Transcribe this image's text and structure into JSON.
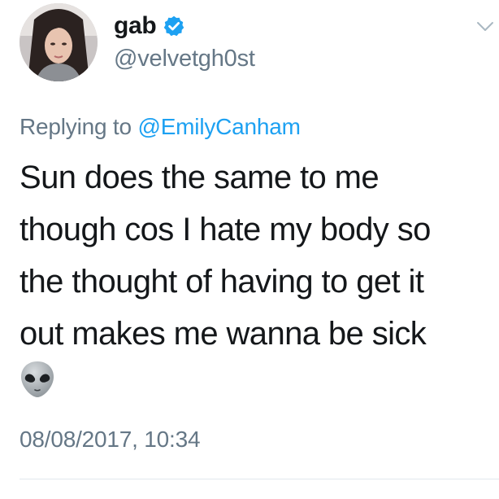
{
  "user": {
    "display_name": "gab",
    "handle": "@velvetgh0st",
    "verified": true
  },
  "reply": {
    "prefix": "Replying to ",
    "mention": "@EmilyCanham"
  },
  "tweet": {
    "lines": [
      "Sun does the same to me",
      "though cos I hate my body so",
      "the thought of having to get it",
      "out makes me wanna be sick"
    ],
    "emoji": "👽",
    "timestamp": "08/08/2017, 10:34"
  },
  "icons": {
    "verified": "verified-badge-icon",
    "menu": "chevron-down-icon",
    "emoji": "alien-emoji-icon"
  },
  "colors": {
    "accent": "#1da1f2",
    "secondary_text": "#657786",
    "primary_text": "#14171a",
    "divider": "#e1e8ed"
  }
}
